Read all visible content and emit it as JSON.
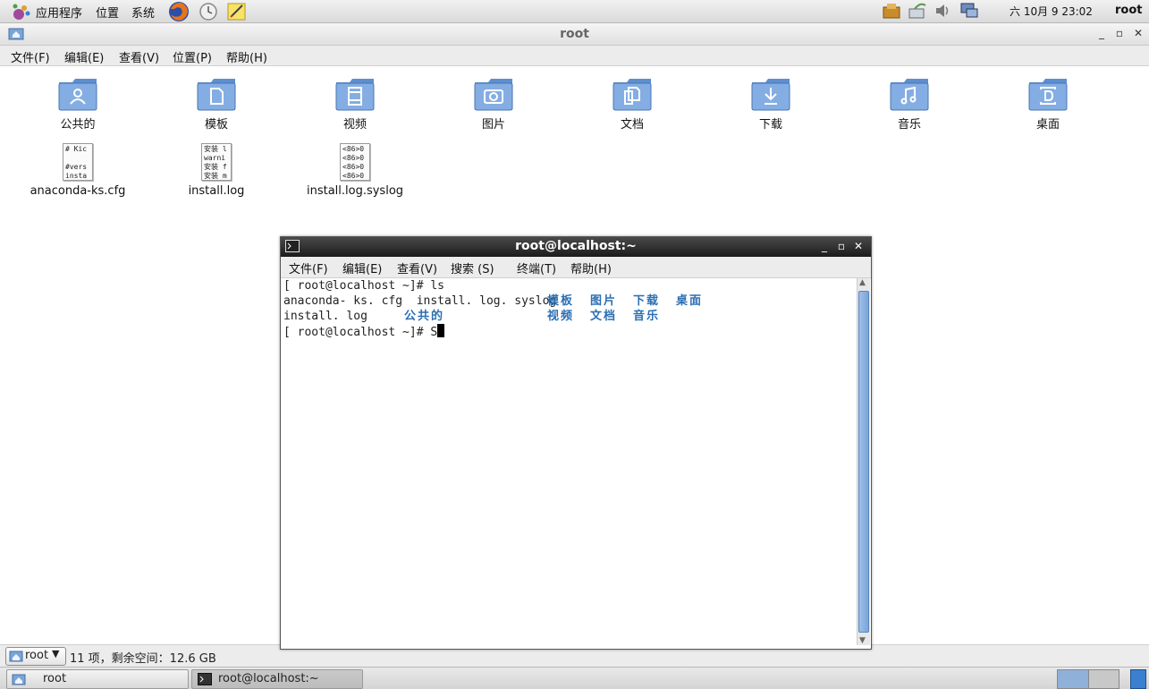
{
  "top_panel": {
    "applications": "应用程序",
    "places": "位置",
    "system": "系统",
    "clock": "六 10月  9 23:02",
    "user": "root"
  },
  "file_manager": {
    "title": "root",
    "menu": [
      "文件(F)",
      "编辑(E)",
      "查看(V)",
      "位置(P)",
      "帮助(H)"
    ],
    "folders": [
      {
        "label": "公共的",
        "icon": "public-folder-icon"
      },
      {
        "label": "模板",
        "icon": "templates-folder-icon"
      },
      {
        "label": "视频",
        "icon": "videos-folder-icon"
      },
      {
        "label": "图片",
        "icon": "pictures-folder-icon"
      },
      {
        "label": "文档",
        "icon": "documents-folder-icon"
      },
      {
        "label": "下载",
        "icon": "downloads-folder-icon"
      },
      {
        "label": "音乐",
        "icon": "music-folder-icon"
      },
      {
        "label": "桌面",
        "icon": "desktop-folder-icon"
      }
    ],
    "files": [
      {
        "label": "anaconda-ks.cfg",
        "preview": [
          "# Kic",
          "",
          "#vers",
          "insta"
        ]
      },
      {
        "label": "install.log",
        "preview": [
          "安装 l",
          "warni",
          "安装 f",
          "安装 m"
        ]
      },
      {
        "label": "install.log.syslog",
        "preview": [
          "<86>0",
          "<86>0",
          "<86>0",
          "<86>0"
        ]
      }
    ],
    "status": {
      "location": "root",
      "info": "11 项，剩余空间：12.6 GB"
    }
  },
  "terminal": {
    "title": "root@localhost:~",
    "menu": [
      "文件(F)",
      "编辑(E)",
      "查看(V)",
      "搜索 (S)",
      "终端(T)",
      "帮助(H)"
    ],
    "lines": {
      "prompt1": "[ root@localhost ~]# ls",
      "row1_files": "anaconda- ks. cfg  install. log. syslog",
      "row2_files": "install. log",
      "prompt2": "[ root@localhost ~]# S"
    },
    "dirs_row1": [
      "模板",
      "图片",
      "下载",
      "桌面"
    ],
    "dirs_row2": [
      "公共的",
      "视频",
      "文档",
      "音乐"
    ]
  },
  "taskbar": {
    "tasks": [
      "root",
      "root@localhost:~"
    ]
  },
  "colors": {
    "folder_blue": "#6f9fd8",
    "terminal_dir": "#2a6fb3",
    "accent": "#4a7fc1"
  }
}
